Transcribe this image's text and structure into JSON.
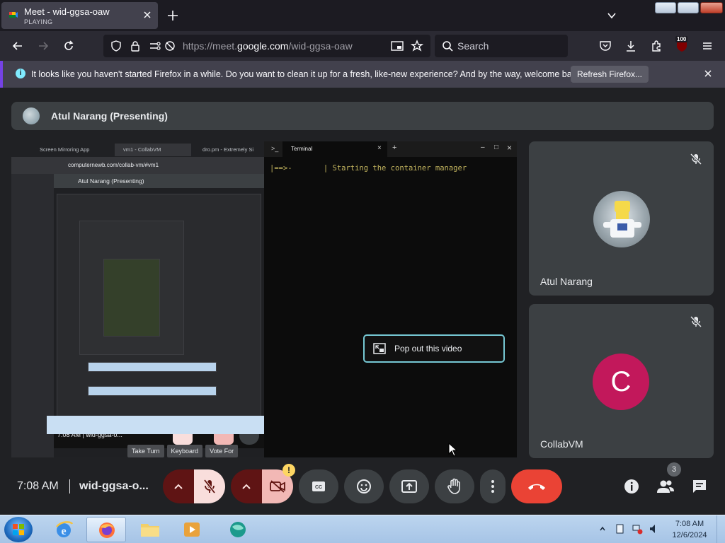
{
  "browser": {
    "tab": {
      "title": "Meet - wid-ggsa-oaw",
      "subtitle": "PLAYING"
    },
    "url": {
      "prefix": "https://meet.",
      "host": "google.com",
      "path": "/wid-ggsa-oaw"
    },
    "search_placeholder": "Search",
    "badge": "100"
  },
  "notification": {
    "text": "It looks like you haven't started Firefox in a while. Do you want to clean it up for a fresh, like-new experience? And by the way, welcome back!",
    "button": "Refresh Firefox..."
  },
  "meet": {
    "presenter_banner": "Atul Narang (Presenting)",
    "shared_screen": {
      "tabs": [
        "Screen Mirroring App",
        "vm1 - CollabVM",
        "dro.pm - Extremely Si"
      ],
      "address": "computernewb.com/collab-vm/#vm1",
      "inner_presenter": "Atul Narang (Presenting)",
      "inner_time": "7:08 AM",
      "inner_code": "wid-ggsa-o...",
      "inner_buttons": [
        "Take Turn",
        "Keyboard",
        "Vote For"
      ],
      "terminal_tab": "Terminal",
      "terminal_line": "|==>-       | Starting the container manager"
    },
    "popout_label": "Pop out this video",
    "participants": [
      {
        "name": "Atul Narang"
      },
      {
        "name": "CollabVM",
        "initial": "C"
      }
    ],
    "time": "7:08 AM",
    "code": "wid-ggsa-o...",
    "people_count": "3",
    "warn_mark": "!"
  },
  "taskbar": {
    "time": "7:08 AM",
    "date": "12/6/2024"
  },
  "colors": {
    "meet_bg": "#202124",
    "tile_bg": "#3c4043",
    "end_call": "#ea4335",
    "collab_avatar": "#c2185b",
    "accent_outline": "#76c8d4"
  }
}
